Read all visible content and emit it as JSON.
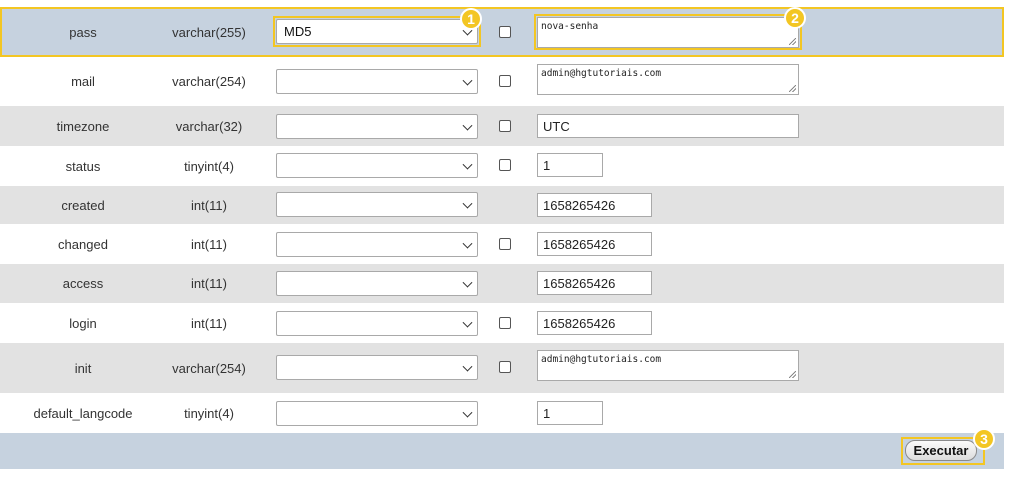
{
  "rows": [
    {
      "name": "pass",
      "type": "varchar(255)",
      "func": "MD5",
      "null": true,
      "value": "nova-senha",
      "input": "textarea"
    },
    {
      "name": "mail",
      "type": "varchar(254)",
      "func": "",
      "null": true,
      "value": "admin@hgtutoriais.com",
      "input": "textarea"
    },
    {
      "name": "timezone",
      "type": "varchar(32)",
      "func": "",
      "null": true,
      "value": "UTC",
      "input": "text"
    },
    {
      "name": "status",
      "type": "tinyint(4)",
      "func": "",
      "null": true,
      "value": "1",
      "input": "number"
    },
    {
      "name": "created",
      "type": "int(11)",
      "func": "",
      "null": false,
      "value": "1658265426",
      "input": "number"
    },
    {
      "name": "changed",
      "type": "int(11)",
      "func": "",
      "null": true,
      "value": "1658265426",
      "input": "number"
    },
    {
      "name": "access",
      "type": "int(11)",
      "func": "",
      "null": false,
      "value": "1658265426",
      "input": "number"
    },
    {
      "name": "login",
      "type": "int(11)",
      "func": "",
      "null": true,
      "value": "1658265426",
      "input": "number"
    },
    {
      "name": "init",
      "type": "varchar(254)",
      "func": "",
      "null": true,
      "value": "admin@hgtutoriais.com",
      "input": "textarea"
    },
    {
      "name": "default_langcode",
      "type": "tinyint(4)",
      "func": "",
      "null": false,
      "value": "1",
      "input": "number"
    }
  ],
  "callouts": [
    "1",
    "2",
    "3"
  ],
  "footer": {
    "execute_label": "Executar"
  },
  "colors": {
    "highlight": "#f3c623",
    "row_grey": "#e2e2e2",
    "row_selected": "#c6d2df"
  }
}
